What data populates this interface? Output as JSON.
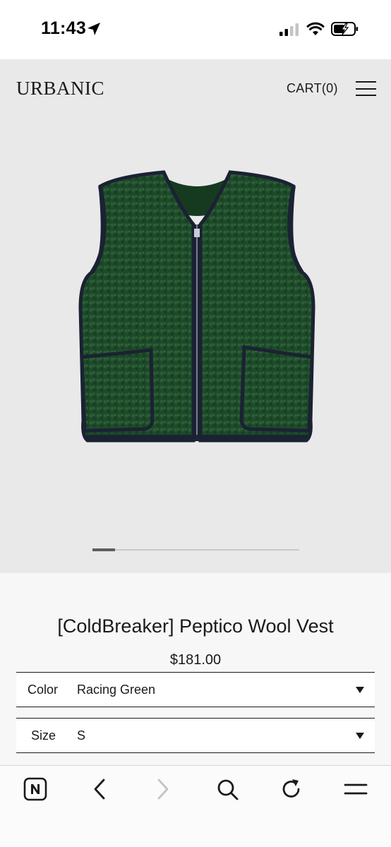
{
  "status_bar": {
    "time": "11:43"
  },
  "header": {
    "brand": "URBANIC",
    "cart_label": "CART(0)"
  },
  "product": {
    "title": "[ColdBreaker] Peptico Wool Vest",
    "price": "$181.00",
    "image_description": "green fleece zip vest",
    "gallery_position": 0.1,
    "options": {
      "color": {
        "label": "Color",
        "value": "Racing Green"
      },
      "size": {
        "label": "Size",
        "value": "S"
      }
    }
  },
  "browser_toolbar": {
    "items": [
      "naver-icon",
      "back-icon",
      "forward-icon",
      "search-icon",
      "reload-icon",
      "menu-icon"
    ]
  },
  "colors": {
    "product_background": "#e9e9e9",
    "vest_green": "#1f4a2a",
    "vest_trim": "#1b2233"
  }
}
